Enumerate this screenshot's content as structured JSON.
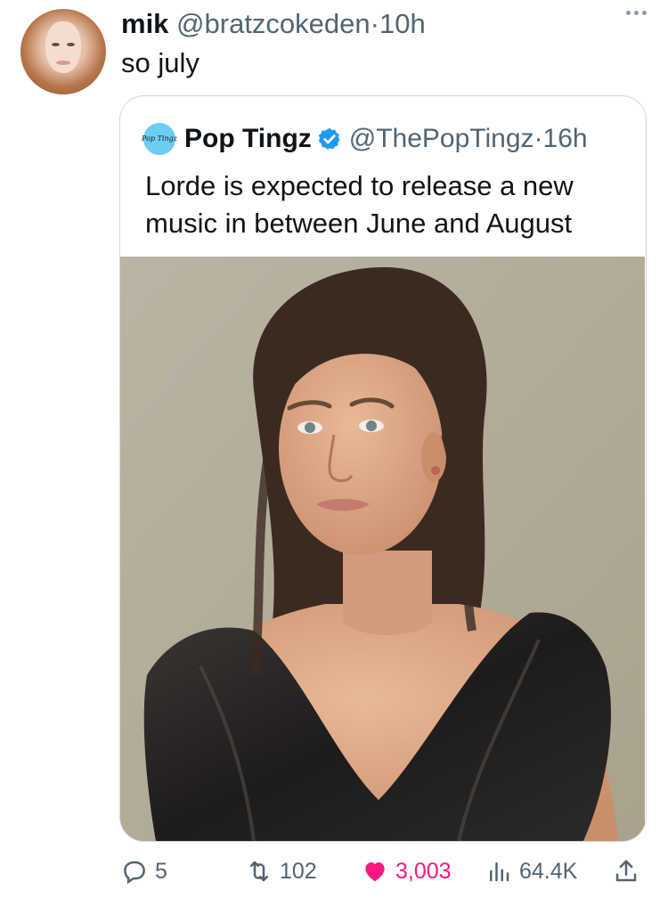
{
  "tweet": {
    "author_name": "mik",
    "handle": "@bratzcokeden",
    "separator": "·",
    "time": "10h",
    "text": "so july",
    "avatar_icon": "profile-photo"
  },
  "quoted_tweet": {
    "avatar_text": "Pop Tingz",
    "author_name": "Pop Tingz",
    "verified": true,
    "handle": "@ThePopTingz",
    "separator": "·",
    "time": "16h",
    "text": "Lorde is expected to release a new music in between June and August",
    "media": "photo-portrait"
  },
  "actions": {
    "replies": "5",
    "retweets": "102",
    "likes": "3,003",
    "views": "64.4K",
    "like_color": "#f91880",
    "muted_color": "#536471"
  },
  "colors": {
    "verified_badge": "#1d9bf0",
    "border": "#cfd9de"
  }
}
